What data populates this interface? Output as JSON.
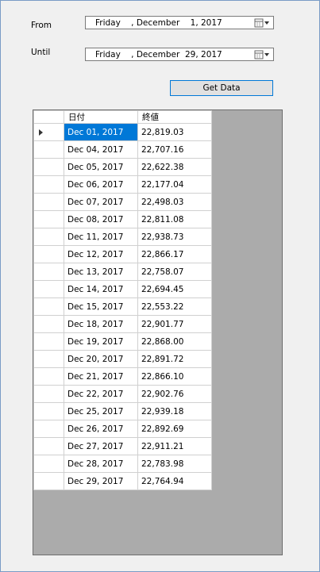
{
  "form": {
    "from_label": "From",
    "until_label": "Until",
    "from_date": "Friday    , December    1, 2017",
    "until_date": "Friday    , December  29, 2017",
    "get_data_label": "Get Data"
  },
  "grid": {
    "columns": [
      "日付",
      "終値"
    ],
    "selected_row": 0,
    "rows": [
      [
        "Dec 01, 2017",
        "22,819.03"
      ],
      [
        "Dec 04, 2017",
        "22,707.16"
      ],
      [
        "Dec 05, 2017",
        "22,622.38"
      ],
      [
        "Dec 06, 2017",
        "22,177.04"
      ],
      [
        "Dec 07, 2017",
        "22,498.03"
      ],
      [
        "Dec 08, 2017",
        "22,811.08"
      ],
      [
        "Dec 11, 2017",
        "22,938.73"
      ],
      [
        "Dec 12, 2017",
        "22,866.17"
      ],
      [
        "Dec 13, 2017",
        "22,758.07"
      ],
      [
        "Dec 14, 2017",
        "22,694.45"
      ],
      [
        "Dec 15, 2017",
        "22,553.22"
      ],
      [
        "Dec 18, 2017",
        "22,901.77"
      ],
      [
        "Dec 19, 2017",
        "22,868.00"
      ],
      [
        "Dec 20, 2017",
        "22,891.72"
      ],
      [
        "Dec 21, 2017",
        "22,866.10"
      ],
      [
        "Dec 22, 2017",
        "22,902.76"
      ],
      [
        "Dec 25, 2017",
        "22,939.18"
      ],
      [
        "Dec 26, 2017",
        "22,892.69"
      ],
      [
        "Dec 27, 2017",
        "22,911.21"
      ],
      [
        "Dec 28, 2017",
        "22,783.98"
      ],
      [
        "Dec 29, 2017",
        "22,764.94"
      ]
    ]
  }
}
